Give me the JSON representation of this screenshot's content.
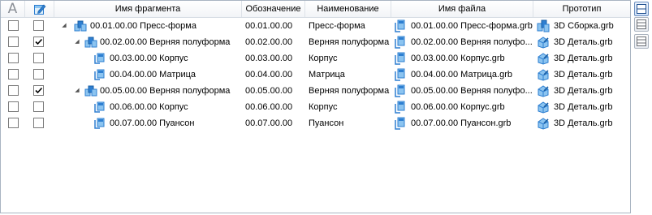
{
  "header": {
    "col_a": "A",
    "col_fragment": "Имя фрагмента",
    "col_designation": "Обозначение",
    "col_name": "Наименование",
    "col_file": "Имя файла",
    "col_prototype": "Прототип"
  },
  "rows": [
    {
      "fragment": "00.01.00.00 Пресс-форма",
      "designation": "00.01.00.00",
      "name": "Пресс-форма",
      "file": "00.01.00.00 Пресс-форма.grb",
      "prototype": "3D Сборка.grb",
      "checked": false,
      "level": 0,
      "expanded": true,
      "kind": "assembly"
    },
    {
      "fragment": "00.02.00.00 Верняя полуформа",
      "designation": "00.02.00.00",
      "name": "Верняя полуформа",
      "file": "00.02.00.00 Верняя полуфо...",
      "prototype": "3D Деталь.grb",
      "checked": true,
      "level": 1,
      "expanded": true,
      "kind": "assembly"
    },
    {
      "fragment": "00.03.00.00 Корпус",
      "designation": "00.03.00.00",
      "name": "Корпус",
      "file": "00.03.00.00 Корпус.grb",
      "prototype": "3D Деталь.grb",
      "checked": false,
      "level": 2,
      "expanded": false,
      "kind": "part"
    },
    {
      "fragment": "00.04.00.00 Матрица",
      "designation": "00.04.00.00",
      "name": "Матрица",
      "file": "00.04.00.00 Матрица.grb",
      "prototype": "3D Деталь.grb",
      "checked": false,
      "level": 2,
      "expanded": false,
      "kind": "part"
    },
    {
      "fragment": "00.05.00.00 Верняя полуформа",
      "designation": "00.05.00.00",
      "name": "Верняя полуформа",
      "file": "00.05.00.00 Верняя полуфо...",
      "prototype": "3D Деталь.grb",
      "checked": true,
      "level": 1,
      "expanded": true,
      "kind": "assembly"
    },
    {
      "fragment": "00.06.00.00 Корпус",
      "designation": "00.06.00.00",
      "name": "Корпус",
      "file": "00.06.00.00 Корпус.grb",
      "prototype": "3D Деталь.grb",
      "checked": false,
      "level": 2,
      "expanded": false,
      "kind": "part"
    },
    {
      "fragment": "00.07.00.00 Пуансон",
      "designation": "00.07.00.00",
      "name": "Пуансон",
      "file": "00.07.00.00 Пуансон.grb",
      "prototype": "3D Деталь.grb",
      "checked": false,
      "level": 2,
      "expanded": false,
      "kind": "part"
    }
  ],
  "icons": {
    "edit_header": "edit-document-icon",
    "assembly": "assembly-icon",
    "part": "part-icon",
    "file": "file-icon",
    "prototype_assembly": "prototype-assembly-icon",
    "prototype_part": "prototype-part-icon"
  },
  "colors": {
    "accent": "#2e7fd1",
    "light_accent": "#8cc4f0",
    "border": "#a9b4c2"
  }
}
